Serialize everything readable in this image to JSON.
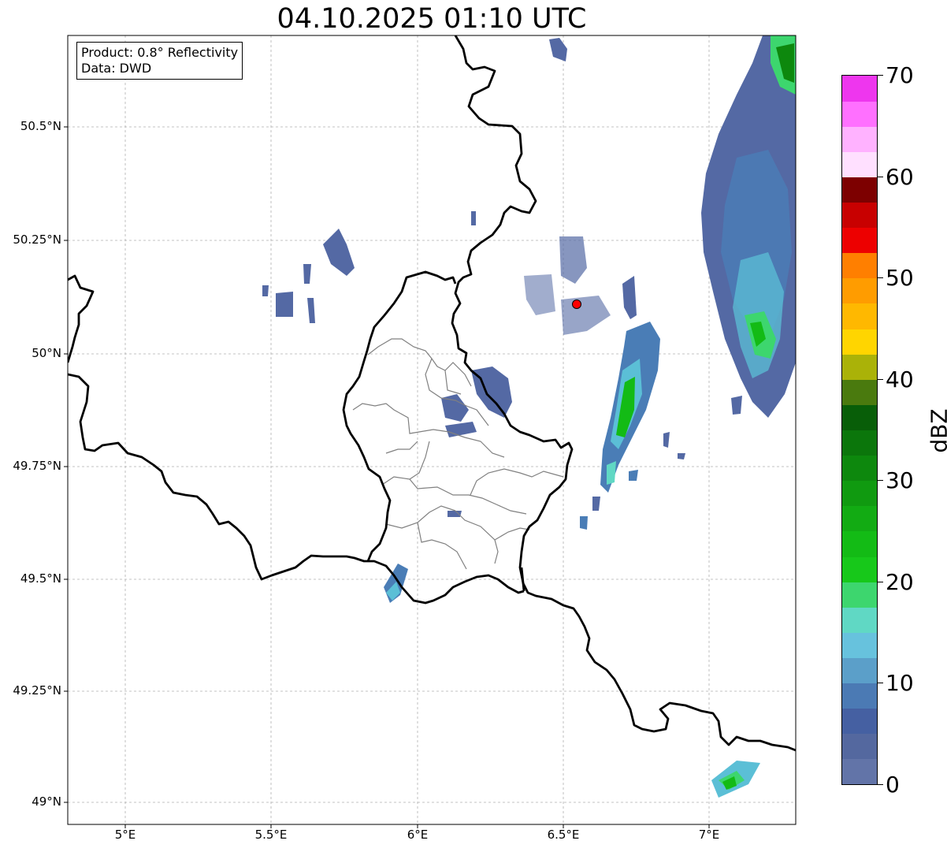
{
  "title": "04.10.2025 01:10 UTC",
  "info": {
    "product": "Product: 0.8° Reflectivity",
    "source": "Data: DWD"
  },
  "lat_labels": [
    "50.5°N",
    "50.25°N",
    "50°N",
    "49.75°N",
    "49.5°N",
    "49.25°N",
    "49°N"
  ],
  "lon_labels": [
    "5°E",
    "5.5°E",
    "6°E",
    "6.5°E",
    "7°E"
  ],
  "colorbar": {
    "unit": "dBZ",
    "tick_labels": [
      "0",
      "10",
      "20",
      "30",
      "40",
      "50",
      "60",
      "70"
    ],
    "colors": [
      "#6274a8",
      "#54689f",
      "#4560a2",
      "#4b7ab4",
      "#5b9fc9",
      "#67c2dd",
      "#60d8c4",
      "#3dd66e",
      "#17c81a",
      "#13bb15",
      "#12ab13",
      "#109a10",
      "#0d880d",
      "#0b760b",
      "#085e08",
      "#4a7a0e",
      "#aab208",
      "#ffd500",
      "#ffb800",
      "#ff9c00",
      "#ff7f00",
      "#ed0000",
      "#c80000",
      "#a50000",
      "#7d0000",
      "#ffe0ff",
      "#ffb2ff",
      "#ff70ff",
      "#ee36ee"
    ]
  },
  "radar_site": {
    "lon": 6.55,
    "lat": 50.11,
    "color": "#ff0000"
  },
  "colors": {
    "border": "#000000",
    "admin": "#808080",
    "grid": "#b0b0b0"
  }
}
